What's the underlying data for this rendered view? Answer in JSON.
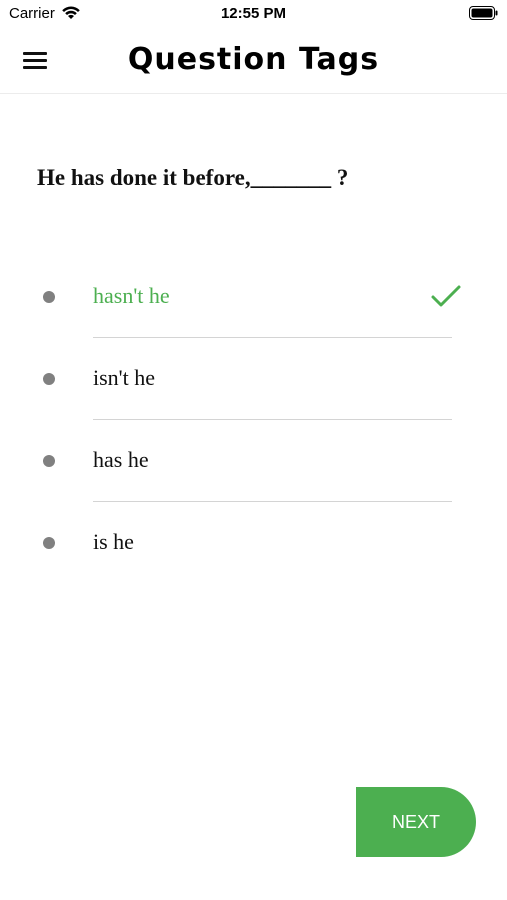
{
  "status_bar": {
    "carrier": "Carrier",
    "time": "12:55 PM"
  },
  "header": {
    "title": "Question Tags",
    "menu_icon": "hamburger-menu-icon"
  },
  "question": {
    "text": "He has done it before,_______ ?"
  },
  "options": [
    {
      "label": "hasn't he",
      "correct": true
    },
    {
      "label": "isn't he",
      "correct": false
    },
    {
      "label": "has he",
      "correct": false
    },
    {
      "label": "is he",
      "correct": false
    }
  ],
  "next_button": {
    "label": "NEXT"
  },
  "colors": {
    "accent": "#4caf50",
    "bullet": "#808080",
    "divider": "#d4d4d4"
  }
}
